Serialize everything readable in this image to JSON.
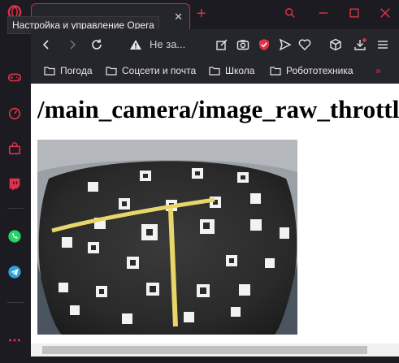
{
  "window": {
    "tab_title": "",
    "tab_close": "✕",
    "new_tab": "+",
    "tooltip": "Настройка и управление Opera"
  },
  "address_bar": {
    "security_text": "Не за..."
  },
  "bookmarks": [
    {
      "label": "Погода"
    },
    {
      "label": "Соцсети и почта"
    },
    {
      "label": "Школа"
    },
    {
      "label": "Робототехника"
    }
  ],
  "bookmarks_more": "»",
  "page": {
    "heading": "/main_camera/image_raw_throttled"
  },
  "colors": {
    "accent": "#e0334a",
    "sidebar": "#1b1b21",
    "toolbar": "#25252c"
  },
  "sidebar_icons": [
    "opera-logo-icon",
    "gamepad-icon",
    "speedometer-icon",
    "shopping-bag-icon",
    "twitch-icon",
    "whatsapp-icon",
    "telegram-icon",
    "more-icon"
  ]
}
